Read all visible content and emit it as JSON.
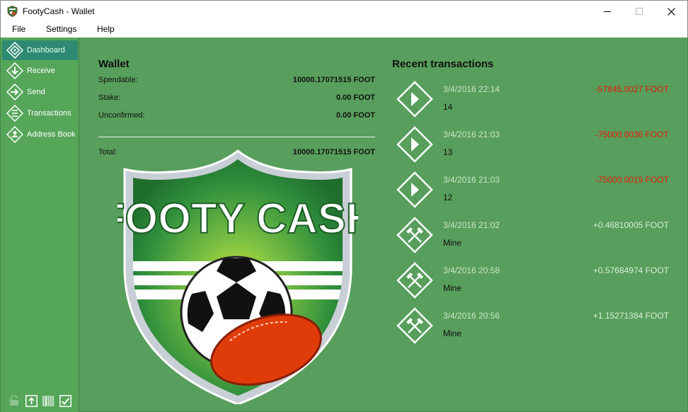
{
  "window": {
    "title": "FootyCash - Wallet"
  },
  "menu": [
    "File",
    "Settings",
    "Help"
  ],
  "sidebar": {
    "items": [
      {
        "label": "Dashboard",
        "icon": "dashboard-icon",
        "active": true
      },
      {
        "label": "Receive",
        "icon": "receive-icon"
      },
      {
        "label": "Send",
        "icon": "send-icon"
      },
      {
        "label": "Transactions",
        "icon": "transactions-icon"
      },
      {
        "label": "Address Book",
        "icon": "address-book-icon"
      }
    ],
    "bottom_icons": [
      "lock-icon",
      "upload-icon",
      "barcode-icon",
      "checkmark-icon"
    ]
  },
  "wallet": {
    "title": "Wallet",
    "spendable_label": "Spendable:",
    "spendable_value": "10000.17071515 FOOT",
    "stake_label": "Stake:",
    "stake_value": "0.00 FOOT",
    "unconfirmed_label": "Unconfirmed:",
    "unconfirmed_value": "0.00 FOOT",
    "total_label": "Total:",
    "total_value": "10000.17071515 FOOT"
  },
  "logo": {
    "text": "FOOTY CASH"
  },
  "recent": {
    "title": "Recent transactions",
    "items": [
      {
        "date": "3/4/2016 22:14",
        "amount": "-57845.0027 FOOT",
        "label": "14",
        "type": "send"
      },
      {
        "date": "3/4/2016 21:03",
        "amount": "-75000.0036 FOOT",
        "label": "13",
        "type": "send"
      },
      {
        "date": "3/4/2016 21:03",
        "amount": "-75000.0019 FOOT",
        "label": "12",
        "type": "send"
      },
      {
        "date": "3/4/2016 21:02",
        "amount": "+0.46810005 FOOT",
        "label": "Mine",
        "type": "mine"
      },
      {
        "date": "3/4/2016 20:58",
        "amount": "+0.57684974 FOOT",
        "label": "Mine",
        "type": "mine"
      },
      {
        "date": "3/4/2016 20:56",
        "amount": "+1.15271384 FOOT",
        "label": "Mine",
        "type": "mine"
      }
    ]
  },
  "colors": {
    "panel_green": "#589e5c",
    "negative": "#e8190b",
    "active_nav": "#2e8a72"
  }
}
